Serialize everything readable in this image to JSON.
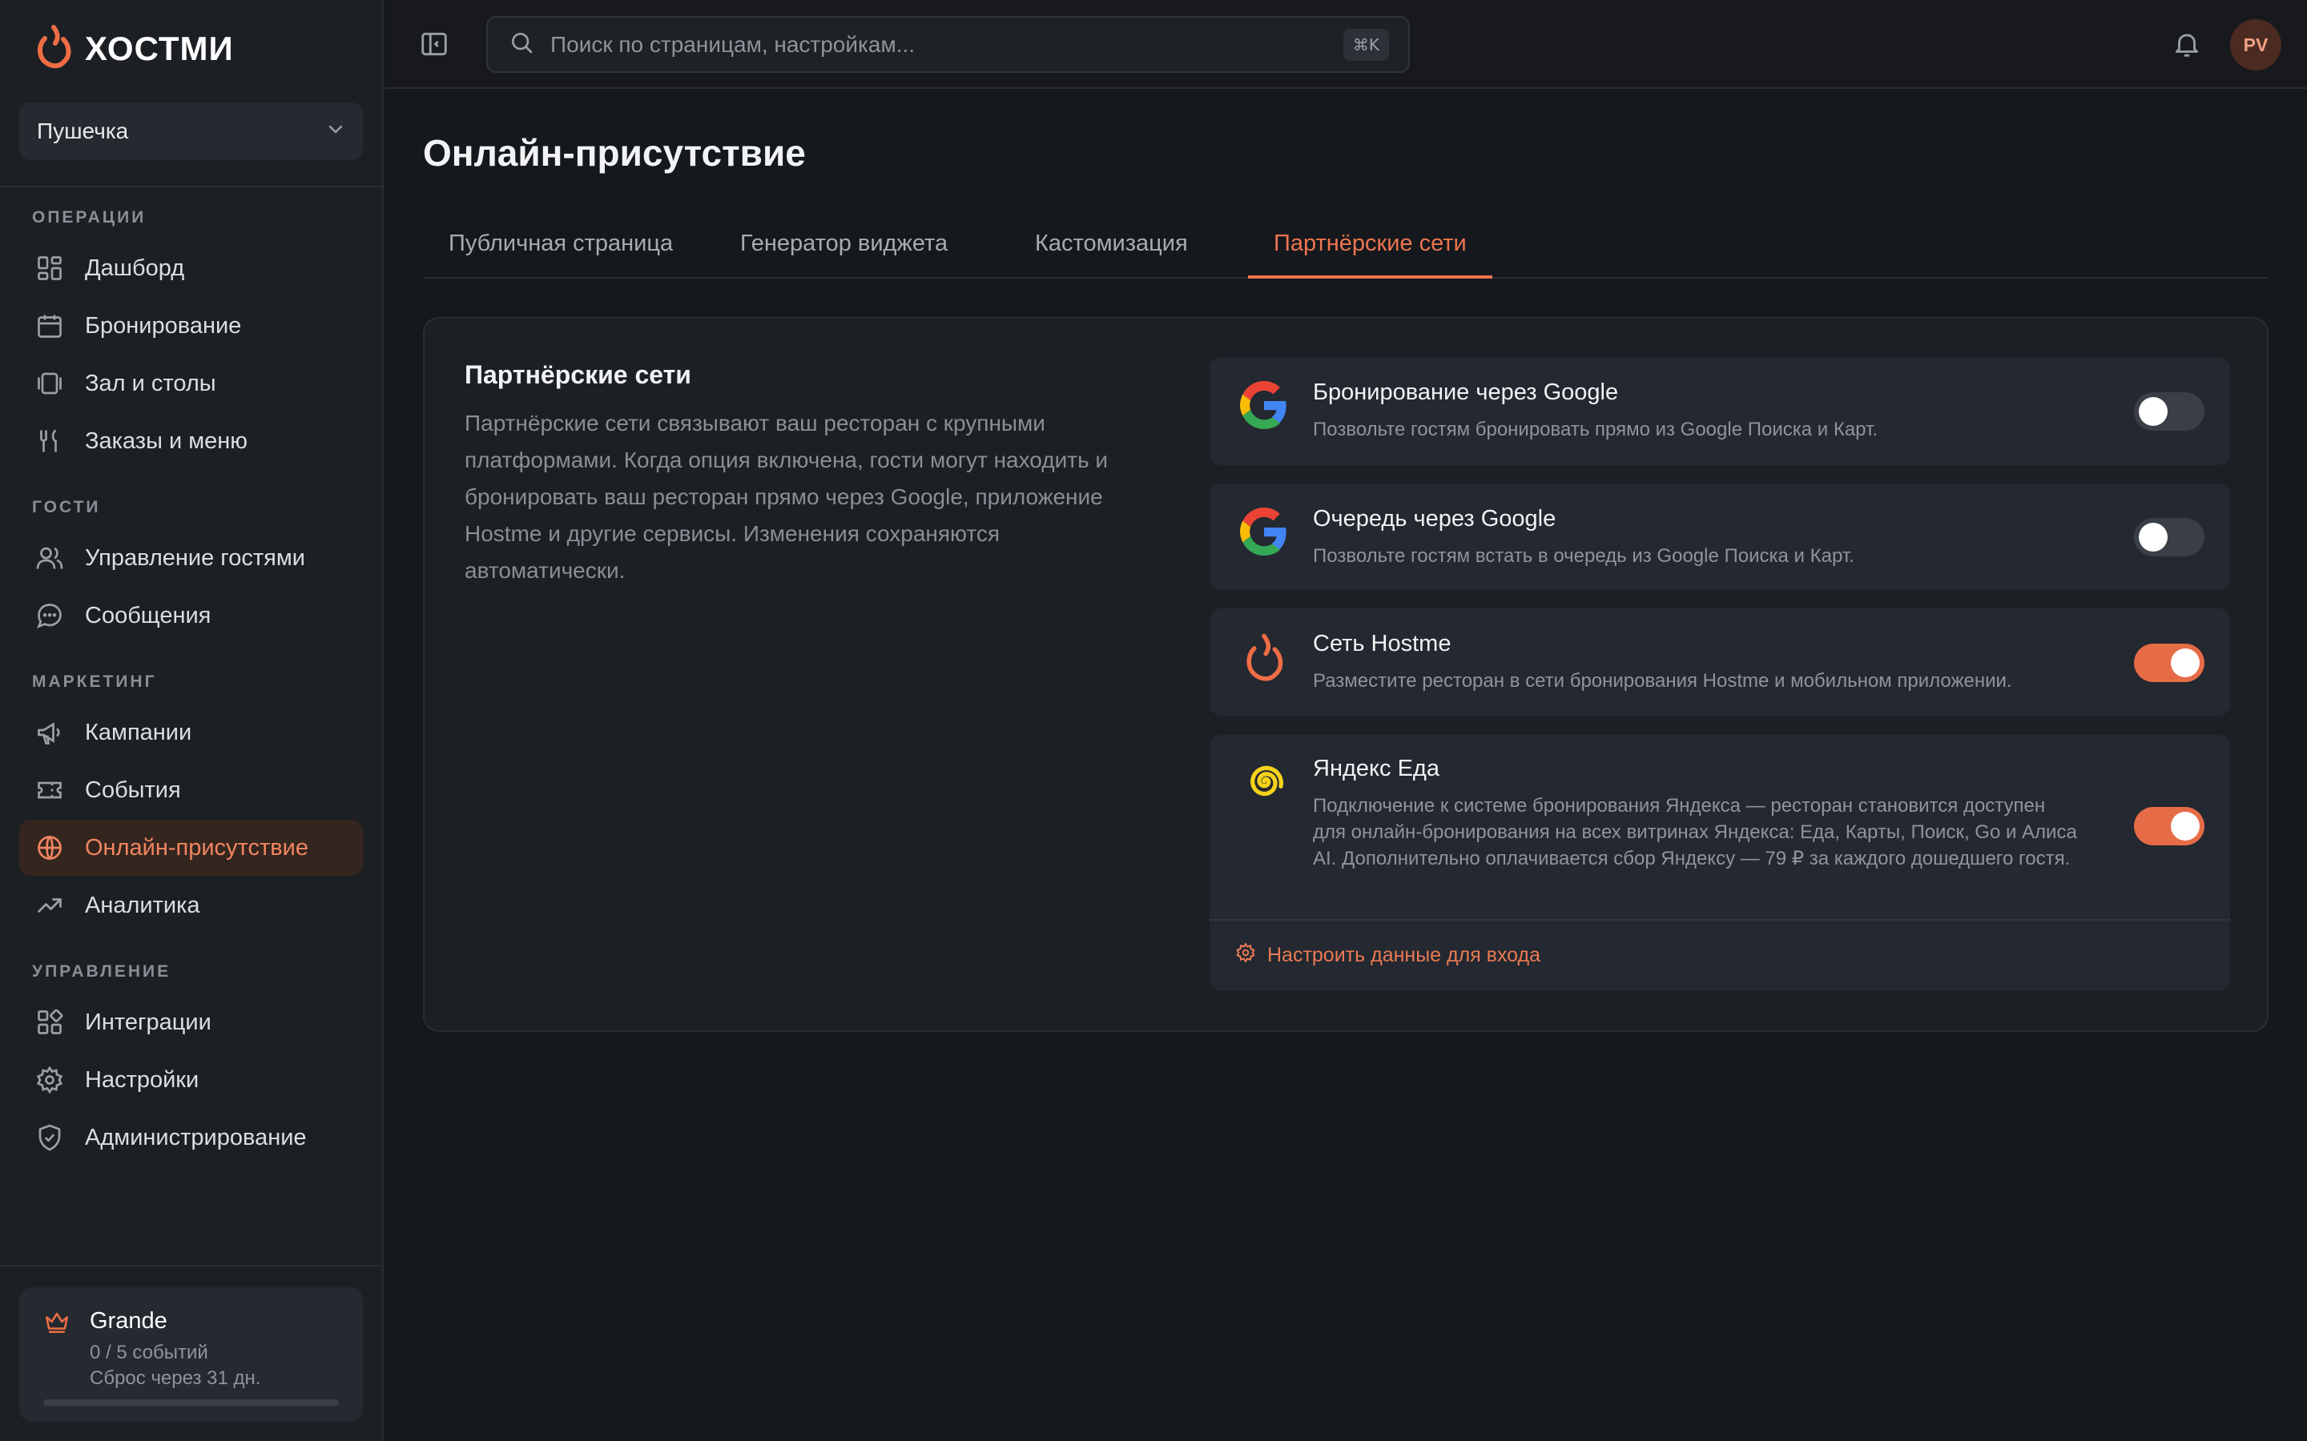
{
  "app": {
    "brand": "ХОСТМИ",
    "venue": "Пушечка"
  },
  "sidebar": {
    "sections": [
      {
        "label": "ОПЕРАЦИИ"
      },
      {
        "label": "ГОСТИ"
      },
      {
        "label": "МАРКЕТИНГ"
      },
      {
        "label": "УПРАВЛЕНИЕ"
      }
    ],
    "items": [
      {
        "label": "Дашборд",
        "icon": "dashboard-icon"
      },
      {
        "label": "Бронирование",
        "icon": "calendar-icon"
      },
      {
        "label": "Зал и столы",
        "icon": "tables-icon"
      },
      {
        "label": "Заказы и меню",
        "icon": "utensils-icon"
      },
      {
        "label": "Управление гостями",
        "icon": "users-icon"
      },
      {
        "label": "Сообщения",
        "icon": "message-icon"
      },
      {
        "label": "Кампании",
        "icon": "megaphone-icon"
      },
      {
        "label": "События",
        "icon": "ticket-icon"
      },
      {
        "label": "Онлайн-присутствие",
        "icon": "globe-icon",
        "active": true
      },
      {
        "label": "Аналитика",
        "icon": "trend-icon"
      },
      {
        "label": "Интеграции",
        "icon": "integrations-icon"
      },
      {
        "label": "Настройки",
        "icon": "gear-icon"
      },
      {
        "label": "Администрирование",
        "icon": "shield-icon"
      }
    ],
    "plan": {
      "name": "Grande",
      "usage": "0 / 5 событий",
      "reset": "Сброс через 31 дн.",
      "progress": 0
    }
  },
  "topbar": {
    "search_placeholder": "Поиск по страницам, настройкам...",
    "shortcut": "⌘K",
    "avatar_initials": "PV"
  },
  "main": {
    "title": "Онлайн-присутствие",
    "tabs": [
      {
        "label": "Публичная страница"
      },
      {
        "label": "Генератор виджета"
      },
      {
        "label": "Кастомизация"
      },
      {
        "label": "Партнёрские сети",
        "active": true
      }
    ],
    "panel": {
      "title": "Партнёрские сети",
      "description": "Партнёрские сети связывают ваш ресторан с крупными платформами. Когда опция включена, гости могут находить и бронировать ваш ресторан прямо через Google, приложение Hostme и другие сервисы. Изменения сохраняются автоматически.",
      "integrations": [
        {
          "title": "Бронирование через Google",
          "description": "Позвольте гостям бронировать прямо из Google Поиска и Карт.",
          "enabled": false,
          "icon": "google-icon"
        },
        {
          "title": "Очередь через Google",
          "description": "Позвольте гостям встать в очередь из Google Поиска и Карт.",
          "enabled": false,
          "icon": "google-icon"
        },
        {
          "title": "Сеть Hostme",
          "description": "Разместите ресторан в сети бронирования Hostme и мобильном приложении.",
          "enabled": true,
          "icon": "hostme-flame-icon"
        },
        {
          "title": "Яндекс Еда",
          "description": "Подключение к системе бронирования Яндекса — ресторан становится доступен для онлайн-бронирования на всех витринах Яндекса: Еда, Карты, Поиск, Go и Алиса AI. Дополнительно оплачивается сбор Яндексу — 79 ₽ за каждого дошедшего гостя.",
          "enabled": true,
          "icon": "yandex-eda-icon",
          "action": "Настроить данные для входа"
        }
      ]
    }
  },
  "colors": {
    "accent": "#ED6D45",
    "background": "#15181C",
    "sidebar": "#1C1F24",
    "card": "#242830"
  }
}
